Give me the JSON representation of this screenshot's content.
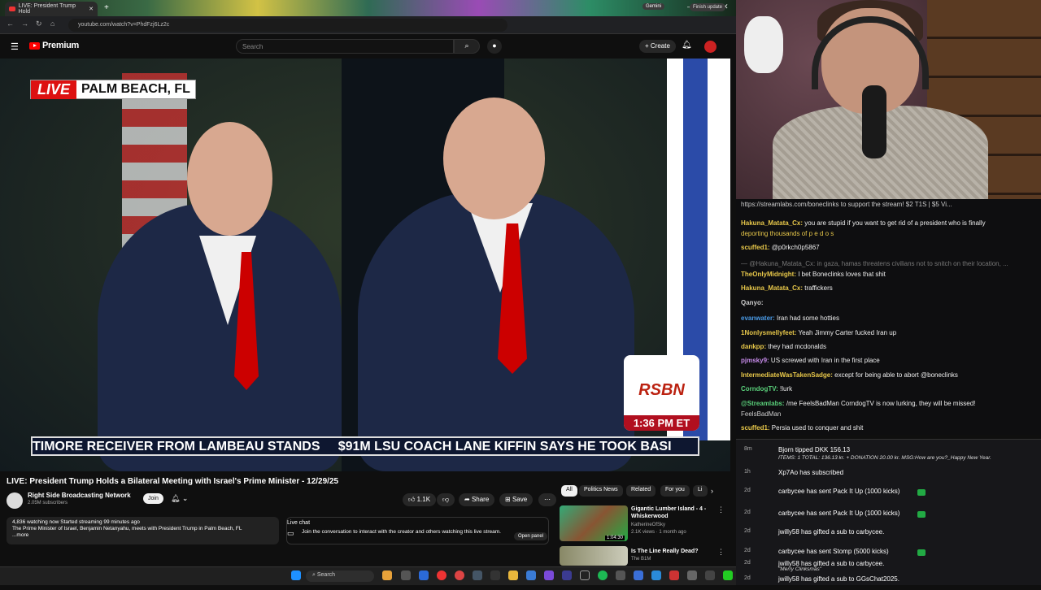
{
  "browser": {
    "tab_title": "LIVE: President Trump Hold",
    "url": "youtube.com/watch?v=PhdFzj6Lz2c",
    "gemini_label": "Gemini",
    "finish_update": "Finish update"
  },
  "yt": {
    "brand": "Premium",
    "search_placeholder": "Search",
    "create_label": "Create"
  },
  "video": {
    "live_word": "LIVE",
    "location": "PALM BEACH, FL",
    "logo": "RSBN",
    "time": "1:36 PM ET",
    "ticker": "TIMORE RECEIVER FROM LAMBEAU STANDS     $91M LSU COACH LANE KIFFIN SAYS HE TOOK BASI"
  },
  "watch": {
    "title": "LIVE: President Trump Holds a Bilateral Meeting with Israel's Prime Minister - 12/29/25",
    "channel": "Right Side Broadcasting Network",
    "subs": "2.05M subscribers",
    "join": "Join",
    "likes": "1.1K",
    "share": "Share",
    "save": "Save",
    "desc_line1": "4,836 watching now  Started streaming 99 minutes ago",
    "desc_line2": "The Prime Minister of Israel, Benjamin Netanyahu, meets with President Trump in Palm Beach, FL",
    "desc_more": "...more",
    "livechat_title": "Live chat",
    "livechat_text": "Join the conversation to interact with the creator and others watching this live stream.",
    "open_panel": "Open panel"
  },
  "chips": [
    "All",
    "Politics News",
    "Related",
    "For you",
    "Li"
  ],
  "related": [
    {
      "title": "Gigantic Lumber Island - 4 - Whiskerwood",
      "channel": "KatherineOfSky",
      "meta": "2.1K views · 1 month ago",
      "duration": "1:04:30"
    },
    {
      "title": "Is The Line Really Dead?",
      "channel": "The B1M",
      "meta": "",
      "duration": ""
    }
  ],
  "chat": {
    "banner": "https://streamlabs.com/boneclinks to support the stream! $2 T1S | $5 Vi...",
    "messages": [
      {
        "name": "Hakuna_Matata_Cx:",
        "text": "you are stupid if you want to get rid of a president who is finally",
        "color": "#e8c84a"
      },
      {
        "name": "",
        "text": "deporting thousands of p e d o s",
        "color": "#e8c84a"
      },
      {
        "name": "scuffed1:",
        "text": "@p0rkch0p5867",
        "color": "#e8c84a"
      },
      {
        "name": "",
        "text": "— @Hakuna_Matata_Cx: in gaza, hamas threatens civilians not to snitch on their location, ...",
        "color": "#777"
      },
      {
        "name": "TheOnlyMidnight:",
        "text": "I bet Boneclinks loves that shit",
        "color": "#e8c84a"
      },
      {
        "name": "Hakuna_Matata_Cx:",
        "text": "traffickers",
        "color": "#e8c84a"
      },
      {
        "name": "Qanyo:",
        "text": "",
        "color": "#ccc"
      },
      {
        "name": "evanwater:",
        "text": "Iran had some hotties",
        "color": "#4a9be8"
      },
      {
        "name": "1Nonlysmellyfeet:",
        "text": "Yeah Jimmy Carter fucked Iran up",
        "color": "#e8c84a"
      },
      {
        "name": "dankpp:",
        "text": "they had mcdonalds",
        "color": "#e8c84a"
      },
      {
        "name": "pjmsky9:",
        "text": "US screwed with Iran in the first place",
        "color": "#c58ae8"
      },
      {
        "name": "IntermediateWasTakenSadge:",
        "text": "except for being able to abort @boneclinks",
        "color": "#e8c84a"
      },
      {
        "name": "CorndogTV:",
        "text": "!lurk",
        "color": "#5ad07a"
      },
      {
        "name": "@Streamlabs:",
        "text": "/me FeelsBadMan CorndogTV is now lurking, they will be missed!",
        "color": "#5ad07a"
      },
      {
        "name": "",
        "text": "FeelsBadMan",
        "color": "#ccc"
      },
      {
        "name": "scuffed1:",
        "text": "Persia used to conquer and shit",
        "color": "#e8c84a"
      }
    ]
  },
  "events": [
    {
      "time": "8m",
      "text": "Bjorn tipped DKK 156.13"
    },
    {
      "time": "",
      "text": "ITEMS: 1 TOTAL: 136.13 kr. + DONATION 20.00 kr. MSG:How are you?_Happy New Year."
    },
    {
      "time": "1h",
      "text": "Xp7Ao has subscribed"
    },
    {
      "time": "2d",
      "text": "carbycee has sent Pack It Up (1000 kicks)"
    },
    {
      "time": "2d",
      "text": "carbycee has sent Pack It Up (1000 kicks)"
    },
    {
      "time": "2d",
      "text": "jwilly58 has gifted a sub to carbycee."
    },
    {
      "time": "2d",
      "text": "carbycee has sent Stomp (5000 kicks)"
    },
    {
      "time": "2d",
      "text": "jwilly58 has gifted a sub to carbycee."
    },
    {
      "time": "",
      "text": "\"Merry Clinksmas\""
    },
    {
      "time": "2d",
      "text": "jwilly58 has gifted a sub to GGsChat2025."
    }
  ],
  "taskbar": {
    "search": "Search"
  }
}
